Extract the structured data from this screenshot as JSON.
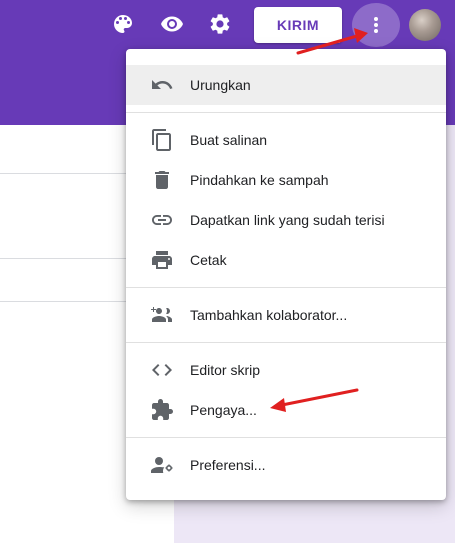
{
  "colors": {
    "brand": "#673ab7",
    "background": "#ede7f6",
    "menu_hover": "#eeeeee",
    "arrow": "#e02020"
  },
  "toolbar": {
    "icons": [
      "palette-icon",
      "preview-eye-icon",
      "settings-gear-icon"
    ],
    "send_label": "KIRIM",
    "more_icon": "more-vert-icon"
  },
  "menu": {
    "items": [
      {
        "label": "Urungkan",
        "icon": "undo-icon",
        "highlighted": true
      },
      {
        "label": "Buat salinan",
        "icon": "copy-icon"
      },
      {
        "label": "Pindahkan ke sampah",
        "icon": "trash-icon"
      },
      {
        "label": "Dapatkan link yang sudah terisi",
        "icon": "link-icon"
      },
      {
        "label": "Cetak",
        "icon": "print-icon"
      },
      {
        "label": "Tambahkan kolaborator...",
        "icon": "add-collaborator-icon"
      },
      {
        "label": "Editor skrip",
        "icon": "code-icon"
      },
      {
        "label": "Pengaya...",
        "icon": "puzzle-piece-icon"
      },
      {
        "label": "Preferensi...",
        "icon": "preferences-icon"
      }
    ]
  }
}
